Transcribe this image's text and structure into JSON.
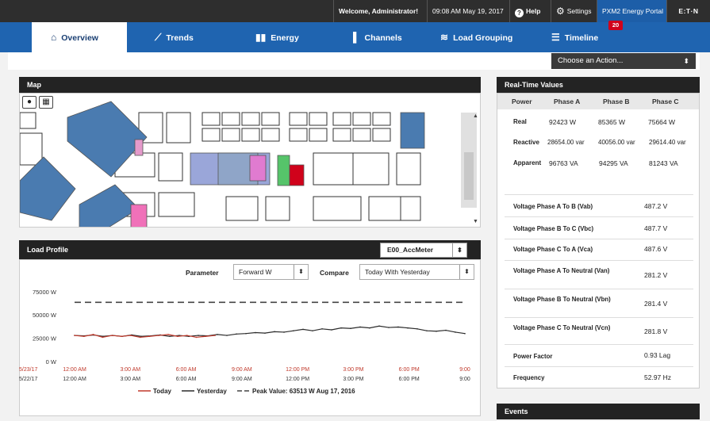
{
  "topbar": {
    "welcome": "Welcome, Administrator!",
    "datetime": "09:08 AM May 19, 2017",
    "help": "Help",
    "settings": "Settings",
    "portal": "PXM2 Energy Portal",
    "logo": "E:T·N"
  },
  "nav": {
    "tabs": [
      {
        "label": "Overview",
        "icon": "home-icon",
        "active": true
      },
      {
        "label": "Trends",
        "icon": "trend-line-icon"
      },
      {
        "label": "Energy",
        "icon": "bar-chart-icon"
      },
      {
        "label": "Channels",
        "icon": "channel-icon"
      },
      {
        "label": "Load Grouping",
        "icon": "stack-icon"
      },
      {
        "label": "Timeline",
        "icon": "list-icon"
      }
    ],
    "timeline_badge": "20"
  },
  "action": {
    "label": "Choose an Action..."
  },
  "map": {
    "title": "Map"
  },
  "load_profile": {
    "title": "Load Profile",
    "meter": "E00_AccMeter",
    "parameter_label": "Parameter",
    "parameter_value": "Forward W",
    "compare_label": "Compare",
    "compare_value": "Today With Yesterday"
  },
  "chart_data": {
    "type": "line",
    "y_ticks": [
      "75000 W",
      "50000 W",
      "25000 W",
      "0 W"
    ],
    "ylim": [
      0,
      85000
    ],
    "x_tick_labels": [
      "12:00 AM",
      "3:00 AM",
      "6:00 AM",
      "9:00 AM",
      "12:00 PM",
      "3:00 PM",
      "6:00 PM",
      "9:00"
    ],
    "row_dates": [
      "5/23/17",
      "5/22/17"
    ],
    "series": [
      {
        "name": "Today",
        "color": "#c0392b",
        "values": [
          28000,
          27000,
          29000,
          26000,
          28000,
          27000,
          28000,
          26000,
          27000,
          28000,
          29000,
          27000,
          28000,
          26000,
          27000,
          28000
        ]
      },
      {
        "name": "Yesterday",
        "color": "#2b2b2b",
        "values": [
          28000,
          27500,
          28500,
          27000,
          28000,
          27000,
          28500,
          27000,
          27500,
          28500,
          27000,
          28000,
          27000,
          28000,
          27500,
          29000,
          28000,
          29500,
          30000,
          31000,
          30500,
          32000,
          31500,
          33000,
          34500,
          33000,
          35000,
          34000,
          36000,
          35500,
          37000,
          36000,
          38000,
          36500,
          37000,
          36000,
          35000,
          33000,
          32500,
          33500,
          31500,
          30000
        ]
      }
    ],
    "peak": {
      "value": 63513,
      "label": "Peak Value: 63513 W Aug 17, 2016",
      "style": "dashed"
    },
    "legend": [
      "Today",
      "Yesterday",
      "Peak Value: 63513 W Aug 17, 2016"
    ]
  },
  "realtime": {
    "title": "Real-Time Values",
    "columns": [
      "Power",
      "Phase A",
      "Phase B",
      "Phase C"
    ],
    "rows": [
      {
        "label": "Real",
        "a": "92423 W",
        "b": "85365 W",
        "c": "75664 W"
      },
      {
        "label": "Reactive",
        "a": "28654.00 var",
        "b": "40056.00 var",
        "c": "29614.40 var"
      },
      {
        "label": "Apparent",
        "a": "96763 VA",
        "b": "94295 VA",
        "c": "81243 VA"
      }
    ],
    "values": [
      {
        "label": "Voltage Phase A To B (Vab)",
        "value": "487.2 V"
      },
      {
        "label": "Voltage Phase B To C (Vbc)",
        "value": "487.7 V"
      },
      {
        "label": "Voltage Phase C To A (Vca)",
        "value": "487.6 V"
      },
      {
        "label": "Voltage Phase A To Neutral (Van)",
        "value": "281.2 V"
      },
      {
        "label": "Voltage Phase B To Neutral (Vbn)",
        "value": "281.4 V"
      },
      {
        "label": "Voltage Phase C To Neutral (Vcn)",
        "value": "281.8 V"
      },
      {
        "label": "Power Factor",
        "value": "0.93 Lag"
      },
      {
        "label": "Frequency",
        "value": "52.97 Hz"
      }
    ]
  },
  "events": {
    "title": "Events"
  }
}
